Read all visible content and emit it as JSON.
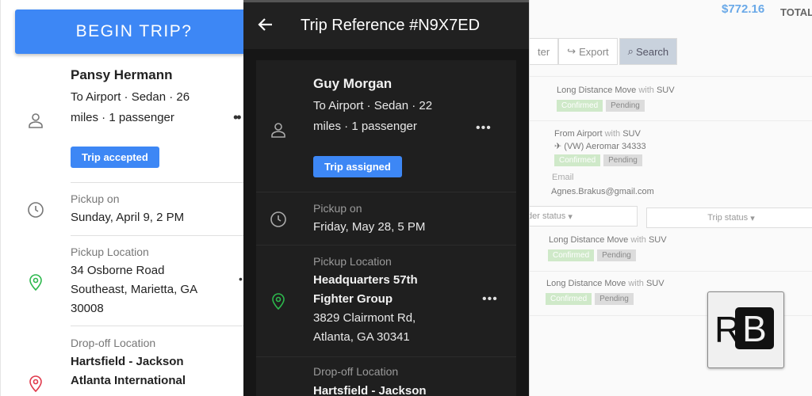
{
  "left": {
    "begin_button": "BEGIN TRIP?",
    "passenger_name": "Pansy Hermann",
    "details": "To Airport · Sedan · 26 miles · 1 passenger",
    "status_badge": "Trip accepted",
    "pickup_on_label": "Pickup on",
    "pickup_on_value": "Sunday, April 9, 2 PM",
    "pickup_location_label": "Pickup Location",
    "pickup_location_value": "34 Osborne Road Southeast, Marietta, GA 30008",
    "dropoff_label": "Drop-off Location",
    "dropoff_value": "Hartsfield - Jackson Atlanta International"
  },
  "middle": {
    "title": "Trip Reference #N9X7ED",
    "passenger_name": "Guy Morgan",
    "details": "To Airport · Sedan · 22 miles · 1 passenger",
    "status_badge": "Trip assigned",
    "pickup_on_label": "Pickup on",
    "pickup_on_value": "Friday, May 28, 5 PM",
    "pickup_location_label": "Pickup Location",
    "pickup_location_name": "Headquarters 57th Fighter Group",
    "pickup_location_address": "3829 Clairmont Rd, Atlanta, GA 30341",
    "dropoff_label": "Drop-off Location",
    "dropoff_value": "Hartsfield - Jackson"
  },
  "right": {
    "amount": "$772.16",
    "total_label": "TOTAL",
    "toolbar": {
      "filter": "ter",
      "export": "Export",
      "search": "Search"
    },
    "rows": [
      {
        "title": "Long Distance Move",
        "with": "with",
        "vehicle": "SUV"
      },
      {
        "title": "From Airport",
        "with": "with",
        "vehicle": "SUV",
        "flight": "(VW) Aeromar 34333"
      },
      {
        "title": "Long Distance Move",
        "with": "with",
        "vehicle": "SUV"
      },
      {
        "title": "Long Distance Move",
        "with": "with",
        "vehicle": "SUV"
      }
    ],
    "tag_confirmed": "Confirmed",
    "tag_pending": "Pending",
    "email_label": "Email",
    "email_value": "Agnes.Brakus@gmail.com",
    "order_status": "der status",
    "trip_status": "Trip status",
    "logo_r": "R",
    "logo_b": "B"
  },
  "colors": {
    "primary_blue": "#3d87f5",
    "pin_green": "#2db84d",
    "pin_red": "#e0394b",
    "dark_bg": "#161616"
  }
}
